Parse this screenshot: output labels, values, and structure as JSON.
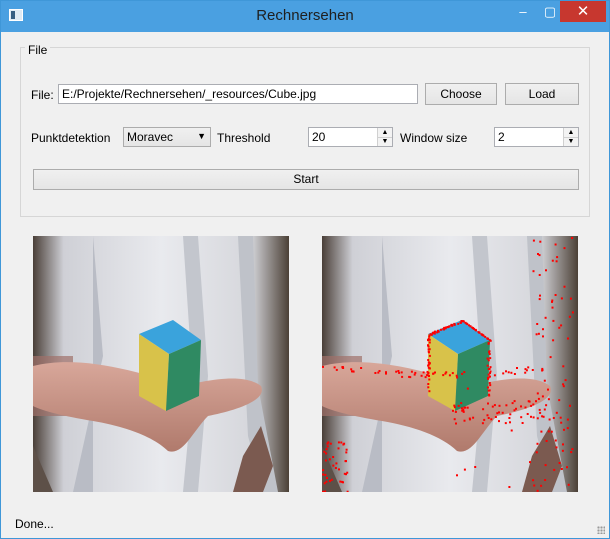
{
  "window": {
    "title": "Rechnersehen",
    "controls": {
      "minimize": "–",
      "maximize": "▢",
      "close": "✕"
    }
  },
  "file_group": {
    "title": "File",
    "file_label": "File:",
    "file_path": "E:/Projekte/Rechnersehen/_resources/Cube.jpg",
    "choose_label": "Choose",
    "load_label": "Load"
  },
  "settings": {
    "detection_label": "Punktdetektion",
    "detection_value": "Moravec",
    "threshold_label": "Threshold",
    "threshold_value": "20",
    "window_size_label": "Window size",
    "window_size_value": "2"
  },
  "start_label": "Start",
  "images": {
    "left": {
      "name": "input image",
      "icon": "photo-cube-hand"
    },
    "right": {
      "name": "result image with red feature points",
      "icon": "photo-cube-hand-points",
      "point_color": "#ff0000"
    }
  },
  "status": "Done...",
  "colors": {
    "titlebar": "#4aa0e1",
    "close_button": "#c7372f",
    "window_bg": "#f0f0f0"
  }
}
